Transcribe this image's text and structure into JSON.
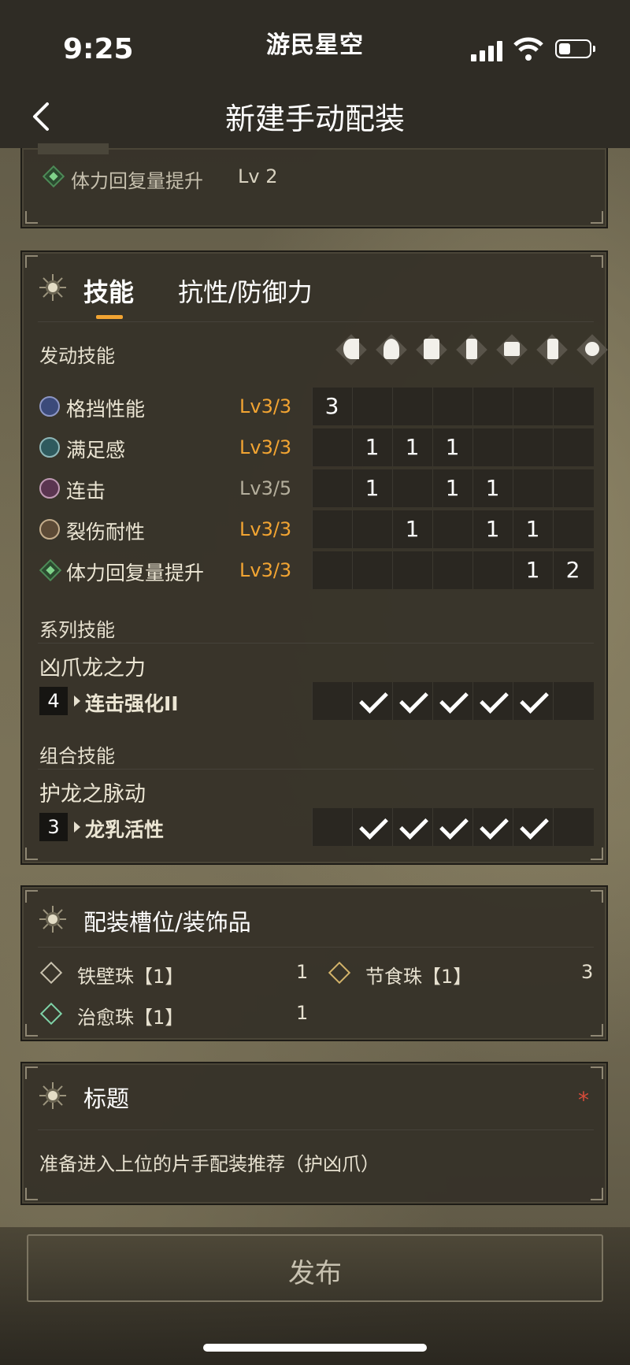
{
  "status_bar": {
    "time": "9:25",
    "brand": "游民星空"
  },
  "nav": {
    "title": "新建手动配装"
  },
  "prev_panel": {
    "skill": "体力回复量提升",
    "level": "Lv 2"
  },
  "skills_panel": {
    "tabs": [
      "技能",
      "抗性/防御力"
    ],
    "active_tab": 0,
    "active_skills_label": "发动技能",
    "equipment_icons": [
      "weapon-icon",
      "helmet-icon",
      "chest-armor-icon",
      "gauntlet-icon",
      "waist-armor-icon",
      "greaves-icon",
      "charm-icon"
    ],
    "skills": [
      {
        "name": "格挡性能",
        "level": "Lv3/3",
        "full": true,
        "cells": [
          "3",
          "",
          "",
          "",
          "",
          "",
          ""
        ]
      },
      {
        "name": "满足感",
        "level": "Lv3/3",
        "full": true,
        "cells": [
          "",
          "1",
          "1",
          "1",
          "",
          "",
          ""
        ]
      },
      {
        "name": "连击",
        "level": "Lv3/5",
        "full": false,
        "cells": [
          "",
          "1",
          "",
          "1",
          "1",
          "",
          ""
        ]
      },
      {
        "name": "裂伤耐性",
        "level": "Lv3/3",
        "full": true,
        "cells": [
          "",
          "",
          "1",
          "",
          "1",
          "1",
          ""
        ]
      },
      {
        "name": "体力回复量提升",
        "level": "Lv3/3",
        "full": true,
        "cells": [
          "",
          "",
          "",
          "",
          "",
          "1",
          "2"
        ]
      }
    ],
    "series_label": "系列技能",
    "series_name": "凶爪龙之力",
    "series_bonus": {
      "count": "4",
      "name": "连击强化II",
      "checks": [
        false,
        true,
        true,
        true,
        true,
        true,
        false
      ]
    },
    "group_label": "组合技能",
    "group_name": "护龙之脉动",
    "group_bonus": {
      "count": "3",
      "name": "龙乳活性",
      "checks": [
        false,
        true,
        true,
        true,
        true,
        true,
        false
      ]
    }
  },
  "decorations_panel": {
    "title": "配装槽位/装饰品",
    "items": [
      {
        "name": "铁壁珠【1】",
        "count": "1"
      },
      {
        "name": "节食珠【1】",
        "count": "3"
      },
      {
        "name": "治愈珠【1】",
        "count": "1"
      }
    ]
  },
  "title_panel": {
    "title": "标题",
    "required_mark": "*",
    "value": "准备进入上位的片手配装推荐（护凶爪）"
  },
  "publish_button": {
    "label": "发布"
  }
}
